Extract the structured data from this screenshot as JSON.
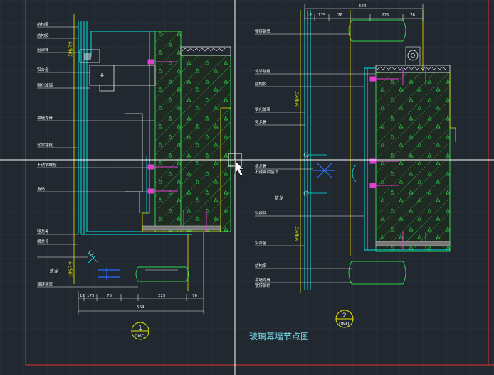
{
  "drawing_title": "玻璃幕墙节点图",
  "details": [
    {
      "number": "1",
      "code": "DMQ"
    },
    {
      "number": "2",
      "code": "DMQ"
    }
  ],
  "left_labels": [
    "结构梁",
    "结构胶",
    "泡沫棒",
    "铝合金",
    "钢化玻璃",
    "幕墙龙骨",
    "化学锚栓",
    "不锈钢螺栓",
    "角码",
    "竖龙骨",
    "横龙骨",
    "镀锌钢管"
  ],
  "right_labels": [
    "镀锌钢管",
    "化学锚栓",
    "结构胶",
    "钢化玻璃",
    "竖龙骨",
    "横龙骨",
    "不锈钢驳接爪",
    "驳接件",
    "铝合金",
    "结构梁",
    "幕墙龙骨",
    "镀锌钢件"
  ],
  "vertical_text": [
    "分格尺寸",
    "分格尺寸",
    "分格尺寸",
    "分格尺寸"
  ],
  "dims_bottom_left": {
    "total": "564",
    "segs": [
      "12",
      "175",
      "76",
      "225",
      "76"
    ]
  },
  "dims_top_right": {
    "total": "564",
    "segs": [
      "12",
      "175",
      "76",
      "225",
      "76"
    ]
  },
  "watermark": "筑龙"
}
